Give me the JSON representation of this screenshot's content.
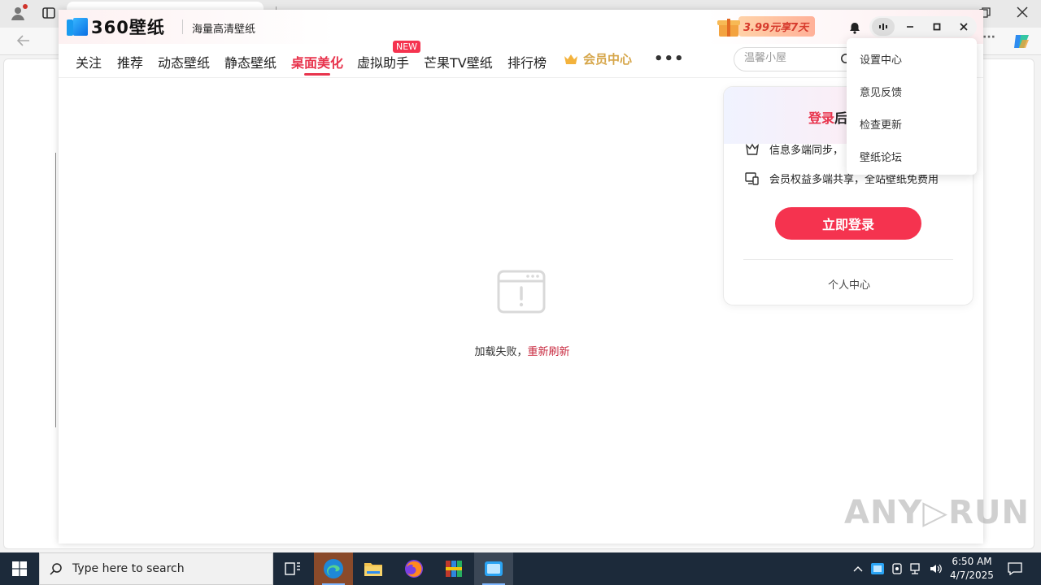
{
  "app": {
    "logo_text": "360壁纸",
    "slogan": "海量高清壁纸",
    "promo_label": "3.99元享7天"
  },
  "nav": {
    "items": [
      {
        "label": "关注",
        "active": false
      },
      {
        "label": "推荐",
        "active": false
      },
      {
        "label": "动态壁纸",
        "active": false
      },
      {
        "label": "静态壁纸",
        "active": false
      },
      {
        "label": "桌面美化",
        "active": true
      },
      {
        "label": "虚拟助手",
        "active": false
      },
      {
        "label": "芒果TV壁纸",
        "active": false
      },
      {
        "label": "排行榜",
        "active": false
      }
    ],
    "new_badge": "NEW",
    "vip_label": "会员中心",
    "more_label": "•••"
  },
  "search": {
    "placeholder": "温馨小屋"
  },
  "error": {
    "message": "加载失败，",
    "reload_label": "重新刷新"
  },
  "login_card": {
    "title_highlight": "登录",
    "title_rest": "后",
    "benefit_1": "信息多端同步，",
    "benefit_2": "会员权益多端共享，全站壁纸免费用",
    "login_button": "立即登录",
    "personal_center": "个人中心"
  },
  "dropdown": {
    "items": [
      "设置中心",
      "意见反馈",
      "检查更新",
      "壁纸论坛"
    ]
  },
  "watermark": "ANY▷RUN",
  "taskbar": {
    "search_placeholder": "Type here to search",
    "time": "6:50 AM",
    "date": "4/7/2025"
  },
  "colors": {
    "accent": "#e8344d",
    "vip_gold": "#d6a64a",
    "taskbar": "#1c2a3a"
  }
}
